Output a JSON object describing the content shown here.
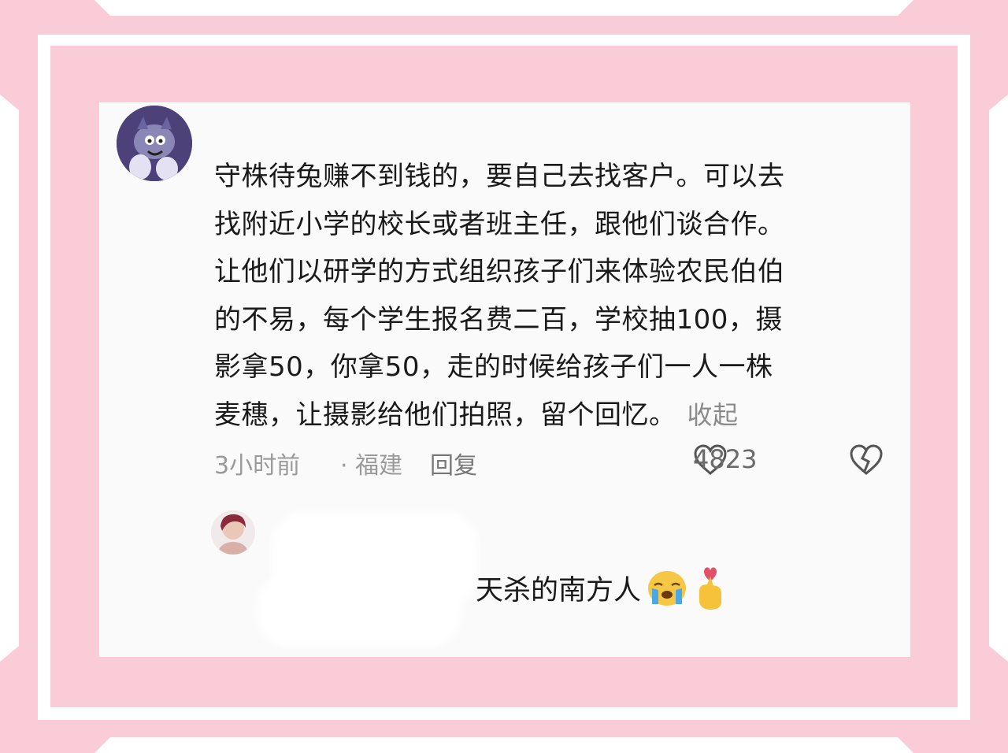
{
  "colors": {
    "frame_pink": "#f9ccd8",
    "card_bg": "#fafafa",
    "text": "#1a1a1a",
    "muted": "#9a9a9a"
  },
  "comment": {
    "lines": [
      "守株待兔赚不到钱的，要自己去找客户。可以去",
      "找附近小学的校长或者班主任，跟他们谈合作。",
      "让他们以研学的方式组织孩子们来体验农民伯伯",
      "的不易，每个学生报名费二百，学校抽100，摄",
      "影拿50，你拿50，走的时候给孩子们一人一株",
      "麦穗，让摄影给他们拍照，留个回忆。"
    ],
    "collapse_label": "收起",
    "time": "3小时前",
    "location": "· 福建",
    "reply_label": "回复",
    "like_count": "4823",
    "icons": {
      "like": "heart-outline-icon",
      "dislike": "broken-heart-icon"
    }
  },
  "reply": {
    "text": "天杀的南方人",
    "emojis": [
      "crying-face-emoji",
      "finger-heart-emoji"
    ]
  }
}
